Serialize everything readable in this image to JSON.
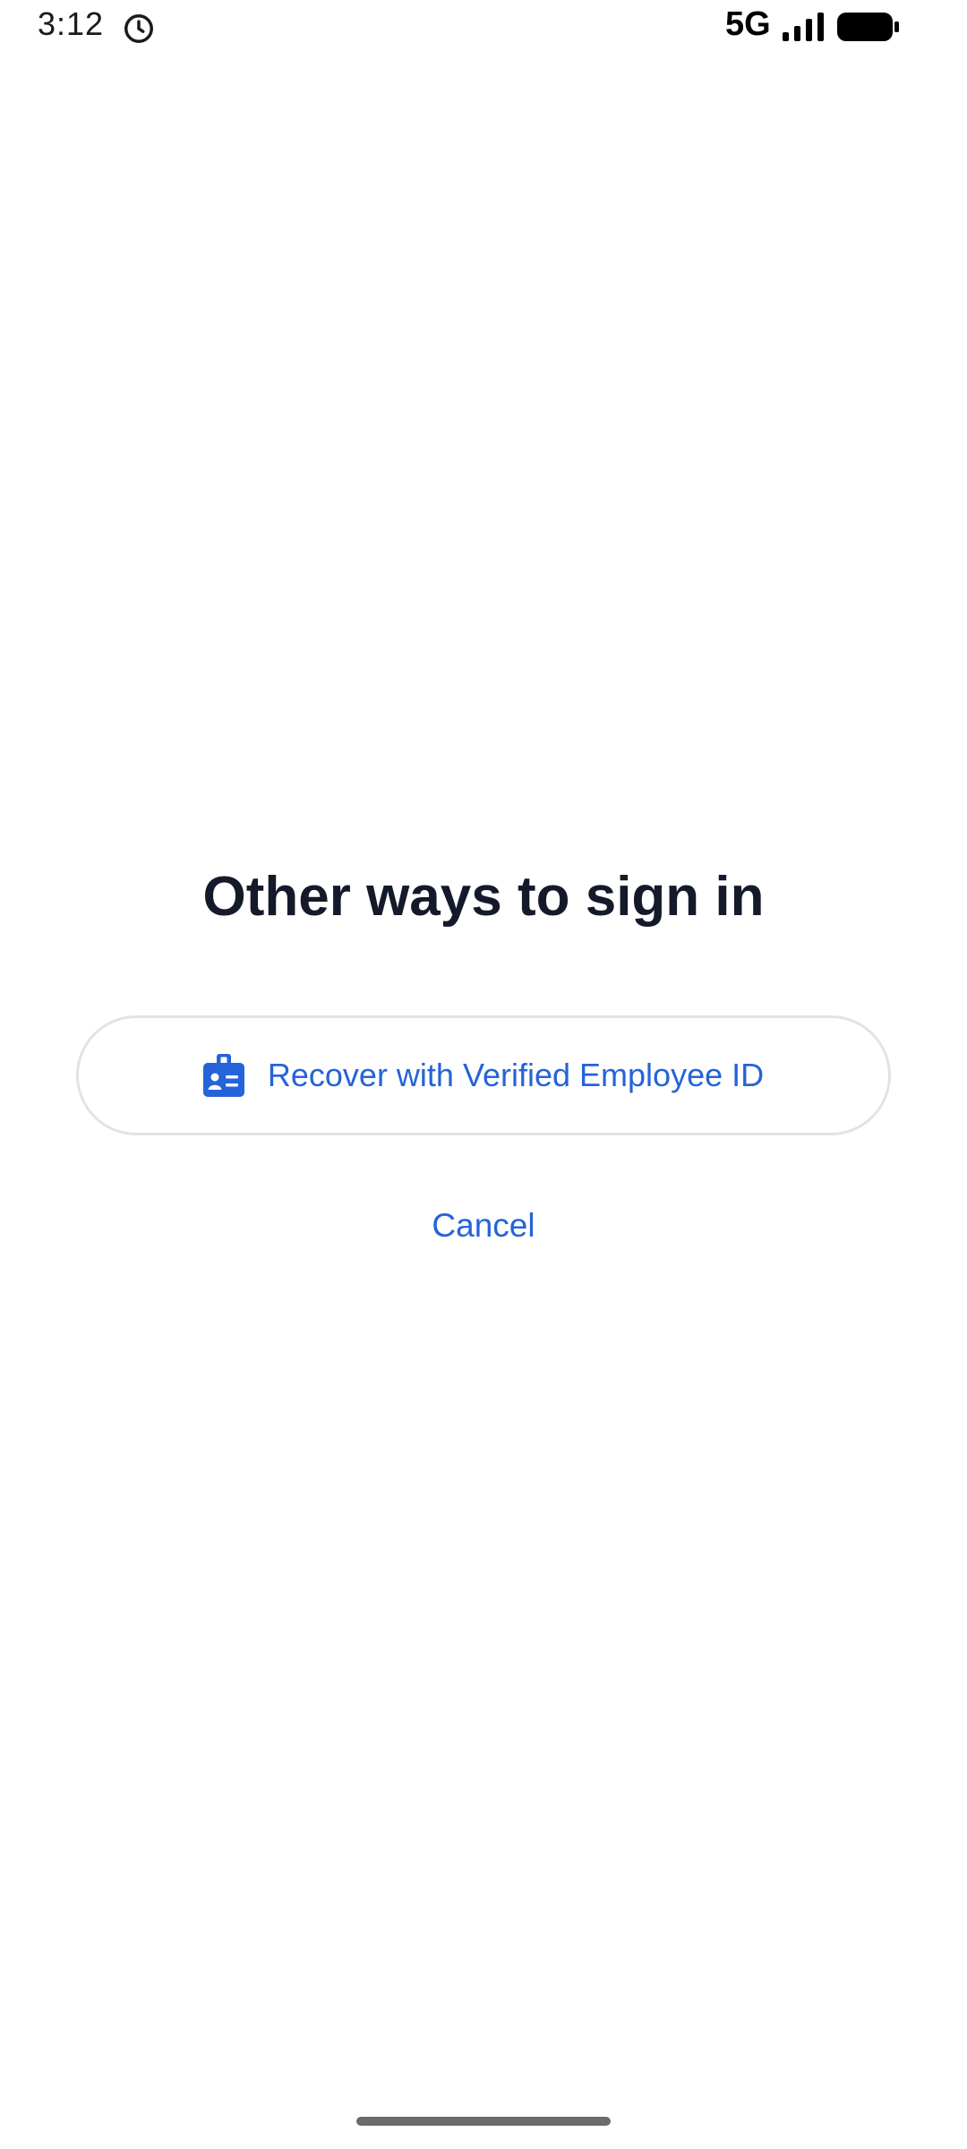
{
  "status_bar": {
    "time": "3:12",
    "network": "5G",
    "icons": [
      "alarm-icon",
      "signal-icon",
      "battery-icon"
    ]
  },
  "page": {
    "title": "Other ways to sign in"
  },
  "recover_button": {
    "icon": "id-badge-icon",
    "label": "Recover with Verified Employee ID"
  },
  "cancel": {
    "label": "Cancel"
  },
  "colors": {
    "accent": "#2563d9",
    "title": "#141a2a",
    "button_border": "#e3e3e6",
    "background": "#ffffff"
  }
}
